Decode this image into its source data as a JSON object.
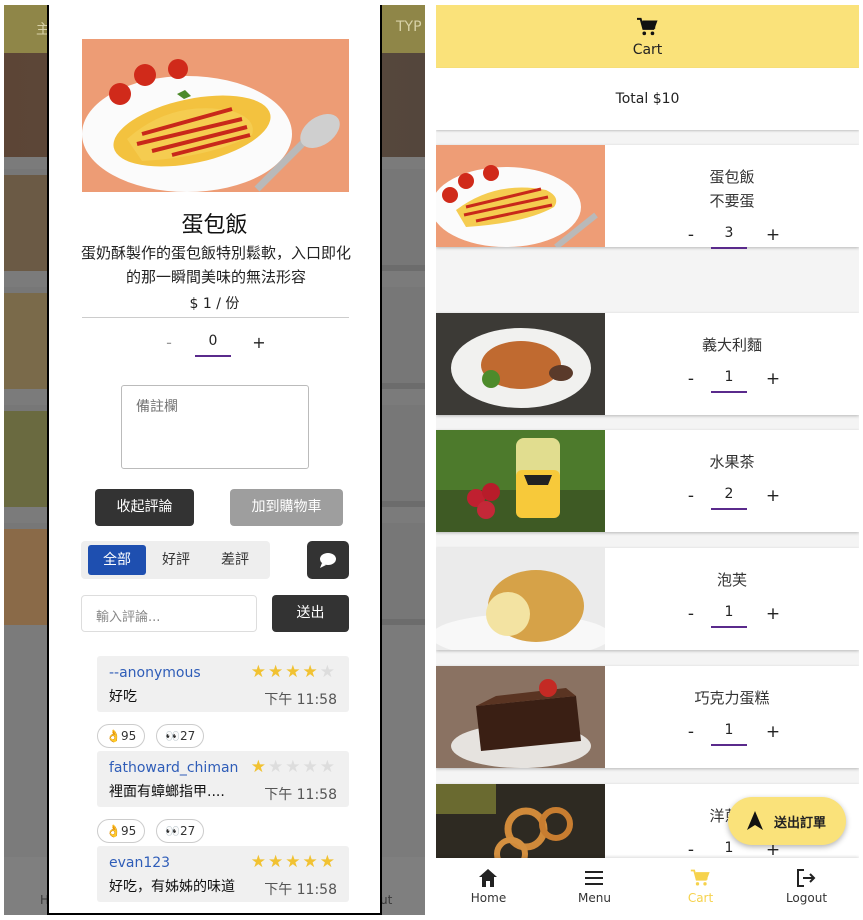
{
  "background_app": {
    "header_left": "主",
    "header_right": "TYP",
    "bottom_left": "H",
    "bottom_right": "ut"
  },
  "modal": {
    "title": "蛋包飯",
    "description": "蛋奶酥製作的蛋包飯特別鬆軟，入口即化的那一瞬間美味的無法形容",
    "price": "$ 1 / 份",
    "quantity": {
      "minus": "-",
      "value": "0",
      "plus": "+"
    },
    "notes_placeholder": "備註欄",
    "collapse_reviews_label": "收起評論",
    "add_to_cart_label": "加到購物車",
    "filter_tabs": [
      "全部",
      "好評",
      "差評"
    ],
    "active_filter": "全部",
    "comment_placeholder": "輸入評論...",
    "submit_label": "送出",
    "reviews": [
      {
        "user": "--anonymous",
        "text": "好吃",
        "time": "下午 11:58",
        "rating": 4,
        "reactions": [
          {
            "emoji": "👌",
            "count": "95"
          },
          {
            "emoji": "👀",
            "count": "27"
          }
        ]
      },
      {
        "user": "fathoward_chiman",
        "text": "裡面有蟑螂指甲....",
        "time": "下午 11:58",
        "rating": 1,
        "reactions": [
          {
            "emoji": "👌",
            "count": "95"
          },
          {
            "emoji": "👀",
            "count": "27"
          }
        ]
      },
      {
        "user": "evan123",
        "text": "好吃，有姊姊的味道",
        "time": "下午 11:58",
        "rating": 5,
        "reactions": []
      }
    ]
  },
  "cart": {
    "header_label": "Cart",
    "total": "Total $10",
    "items": [
      {
        "name": "蛋包飯",
        "note": "不要蛋",
        "qty": "3"
      },
      {
        "name": "義大利麵",
        "note": "",
        "qty": "1"
      },
      {
        "name": "水果茶",
        "note": "",
        "qty": "2"
      },
      {
        "name": "泡芙",
        "note": "",
        "qty": "1"
      },
      {
        "name": "巧克力蛋糕",
        "note": "",
        "qty": "1"
      },
      {
        "name": "洋蔥圈",
        "note": "",
        "qty": "1"
      }
    ],
    "stepper_minus": "-",
    "stepper_plus": "+",
    "fab_label": "送出訂單",
    "nav": [
      {
        "label": "Home",
        "icon": "home-icon"
      },
      {
        "label": "Menu",
        "icon": "menu-icon"
      },
      {
        "label": "Cart",
        "icon": "cart-icon"
      },
      {
        "label": "Logout",
        "icon": "logout-icon"
      }
    ],
    "active_nav": "Cart"
  },
  "colors": {
    "accent_yellow": "#fae27a",
    "active_blue": "#1e4fb0",
    "underline_purple": "#5a2a8c",
    "star": "#f1c232"
  }
}
